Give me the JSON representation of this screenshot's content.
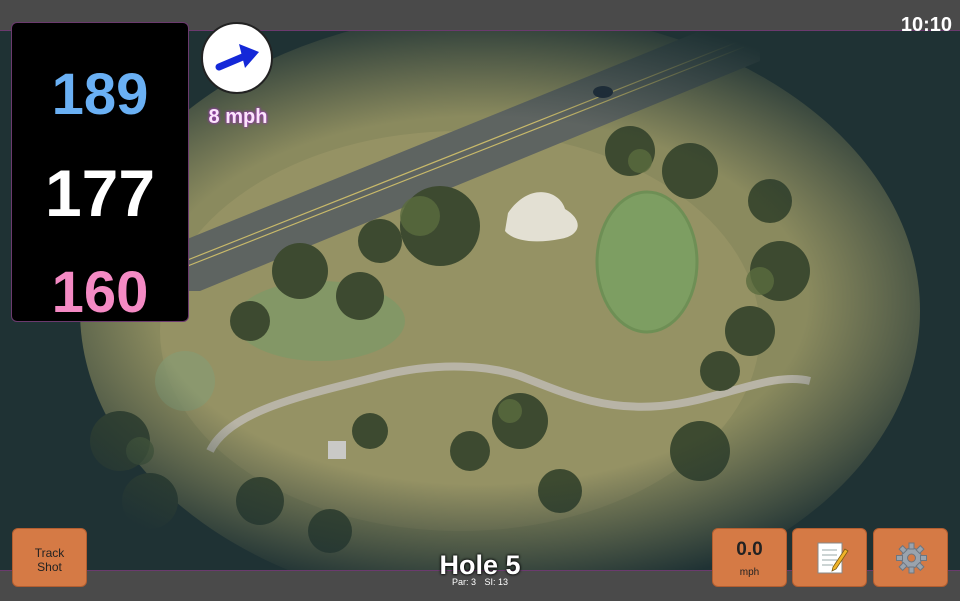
{
  "status": {
    "time": "10:10"
  },
  "yardage": {
    "back": "189",
    "middle": "177",
    "front": "160"
  },
  "wind": {
    "speed_label": "8 mph",
    "icon": "wind-arrow-icon"
  },
  "hole": {
    "title": "Hole 5",
    "par_label": "Par: 3",
    "si_label": "SI: 13"
  },
  "buttons": {
    "track_line1": "Track",
    "track_line2": "Shot",
    "speed_value": "0.0",
    "speed_unit": "mph",
    "notes_icon": "notepad-icon",
    "settings_icon": "gear-icon"
  },
  "colors": {
    "back": "#6ab0f4",
    "middle": "#ffffff",
    "front": "#f48ac4",
    "button": "#d57a45",
    "accent": "#6b3a6e"
  }
}
